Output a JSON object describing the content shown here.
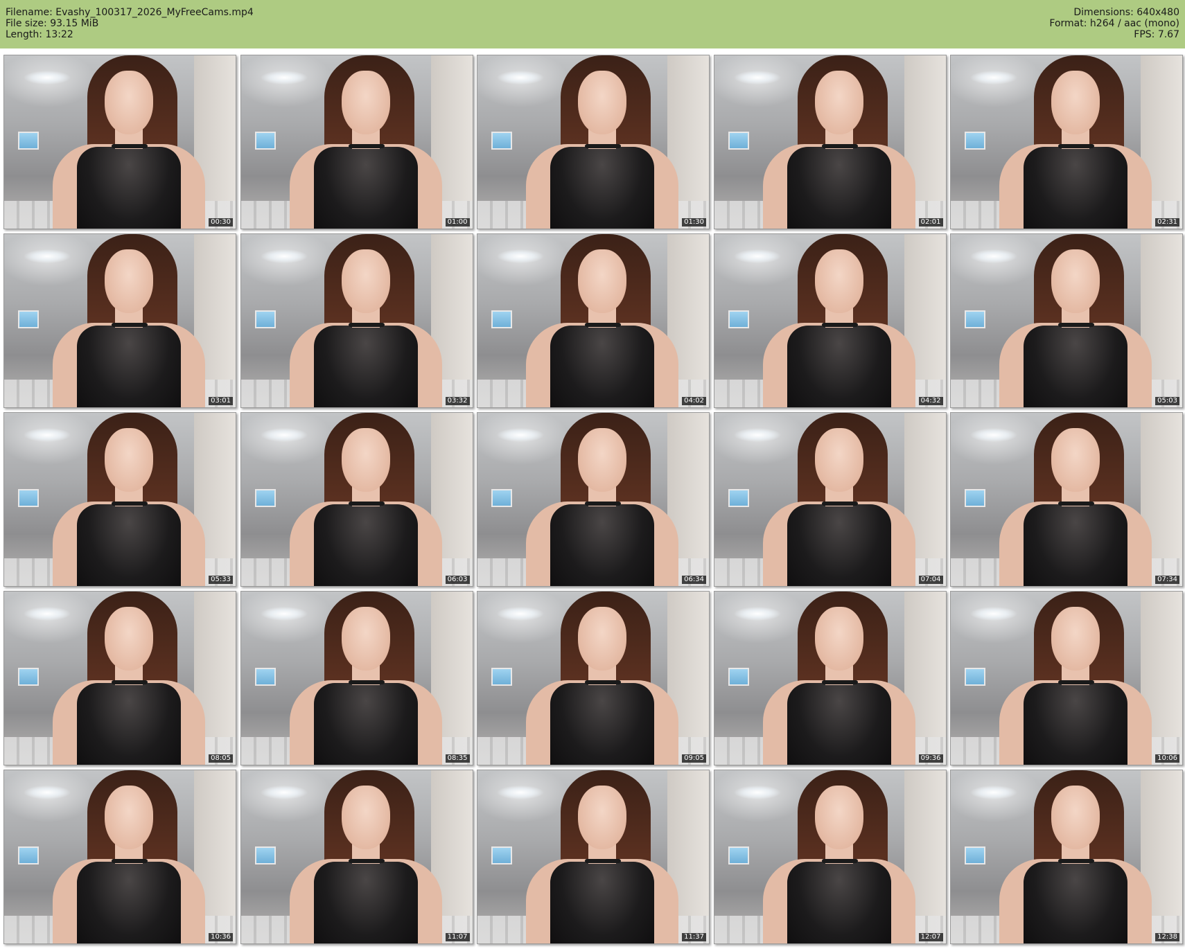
{
  "header": {
    "filename": "Filename: Evashy_100317_2026_MyFreeCams.mp4",
    "filesize": "File size: 93.15 MiB",
    "length": "Length: 13:22",
    "dimensions": "Dimensions: 640x480",
    "format": "Format: h264 / aac (mono)",
    "fps": "FPS: 7.67",
    "background_color": "#aecb82"
  },
  "thumbnails": [
    {
      "timestamp": "00:30"
    },
    {
      "timestamp": "01:00"
    },
    {
      "timestamp": "01:30"
    },
    {
      "timestamp": "02:01"
    },
    {
      "timestamp": "02:31"
    },
    {
      "timestamp": "03:01"
    },
    {
      "timestamp": "03:32"
    },
    {
      "timestamp": "04:02"
    },
    {
      "timestamp": "04:32"
    },
    {
      "timestamp": "05:03"
    },
    {
      "timestamp": "05:33"
    },
    {
      "timestamp": "06:03"
    },
    {
      "timestamp": "06:34"
    },
    {
      "timestamp": "07:04"
    },
    {
      "timestamp": "07:34"
    },
    {
      "timestamp": "08:05"
    },
    {
      "timestamp": "08:35"
    },
    {
      "timestamp": "09:05"
    },
    {
      "timestamp": "09:36"
    },
    {
      "timestamp": "10:06"
    },
    {
      "timestamp": "10:36"
    },
    {
      "timestamp": "11:07"
    },
    {
      "timestamp": "11:37"
    },
    {
      "timestamp": "12:07"
    },
    {
      "timestamp": "12:38"
    }
  ]
}
